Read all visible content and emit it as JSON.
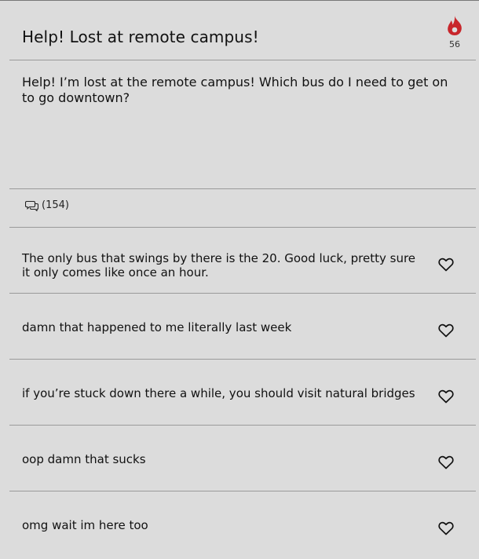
{
  "post": {
    "title": "Help! Lost at remote campus!",
    "vote_count": "56",
    "body": "Help! I’m lost at the remote campus! Which bus do I need to get on to go downtown?",
    "comment_count": "(154)"
  },
  "icons": {
    "vote": "flame-icon",
    "comments": "speech-bubbles-icon",
    "like": "heart-outline-icon"
  },
  "colors": {
    "flame": "#c8262b",
    "background": "#dcdcdc"
  },
  "comments": [
    {
      "text": "The only bus that swings by there is the 20. Good luck, pretty sure it only comes like once an hour."
    },
    {
      "text": "damn that happened to me literally last week"
    },
    {
      "text": "if you’re stuck down there a while, you should visit natural bridges"
    },
    {
      "text": "oop damn that sucks"
    },
    {
      "text": "omg wait im here too"
    }
  ]
}
